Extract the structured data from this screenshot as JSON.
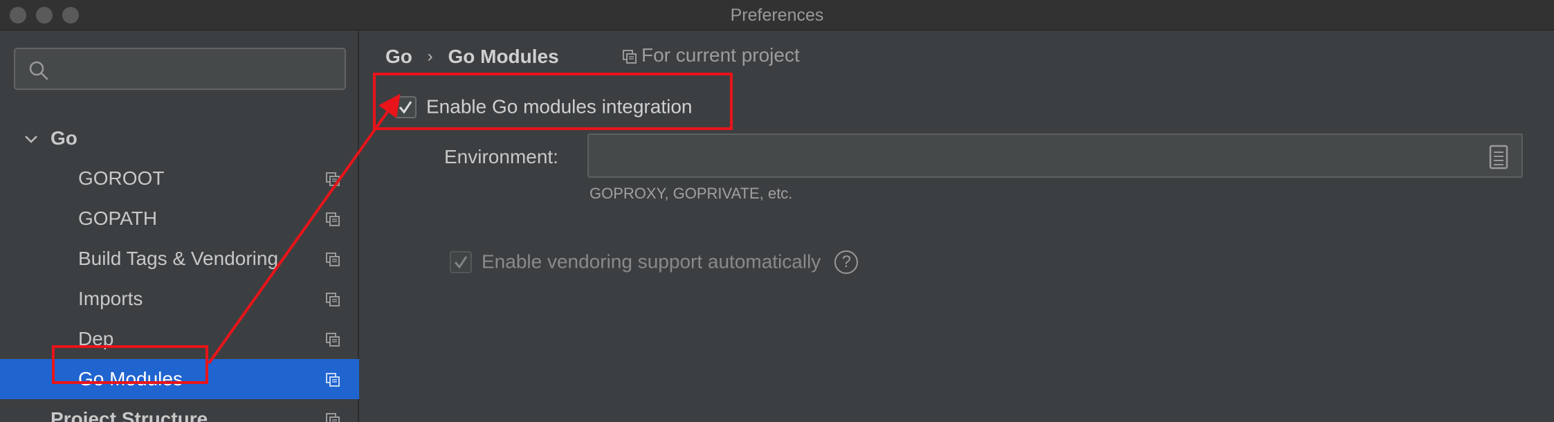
{
  "window": {
    "title": "Preferences"
  },
  "sidebar": {
    "search": {
      "placeholder": ""
    },
    "group": {
      "label": "Go"
    },
    "items": [
      {
        "label": "GOROOT"
      },
      {
        "label": "GOPATH"
      },
      {
        "label": "Build Tags & Vendoring"
      },
      {
        "label": "Imports"
      },
      {
        "label": "Dep"
      },
      {
        "label": "Go Modules",
        "selected": true
      }
    ],
    "next_group": {
      "label": "Project Structure"
    }
  },
  "main": {
    "breadcrumb": [
      "Go",
      "Go Modules"
    ],
    "breadcrumb_separator": "›",
    "scope": "For current project",
    "enable_modules": {
      "label": "Enable Go modules integration",
      "checked": true
    },
    "environment": {
      "label": "Environment:",
      "value": "",
      "hint": "GOPROXY, GOPRIVATE, etc."
    },
    "vendoring": {
      "label": "Enable vendoring support automatically",
      "checked": true,
      "enabled": false
    },
    "help_glyph": "?"
  },
  "colors": {
    "background": "#3c3f41",
    "selection": "#2064d0",
    "annotation": "#e8141a"
  }
}
